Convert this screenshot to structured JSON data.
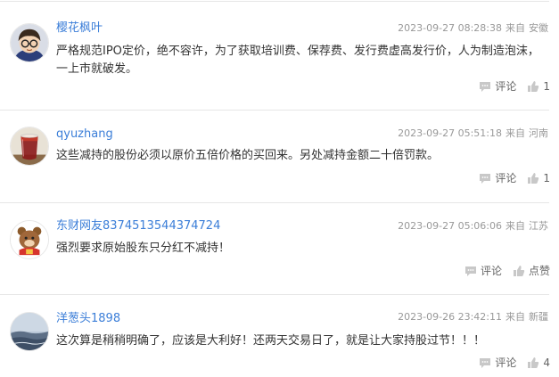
{
  "comments": [
    {
      "username": "樱花枫叶",
      "date": "2023-09-27 08:28:38",
      "source": "来自",
      "location": "安徽",
      "content": "严格规范IPO定价，绝不容许，为了获取培训费、保荐费、发行费虚高发行价，人为制造泡沫，一上市就破发。",
      "reply_label": "评论",
      "like_label": "1"
    },
    {
      "username": "qyuzhang",
      "date": "2023-09-27 05:51:18",
      "source": "来自",
      "location": "河南",
      "content": "这些减持的股份必须以原价五倍价格的买回来。另处减持金额二十倍罚款。",
      "reply_label": "评论",
      "like_label": "1"
    },
    {
      "username": "东财网友8374513544374724",
      "date": "2023-09-27 05:06:06",
      "source": "来自",
      "location": "江苏",
      "content": "强烈要求原始股东只分红不减持！",
      "reply_label": "评论",
      "like_label": "点赞"
    },
    {
      "username": "洋葱头1898",
      "date": "2023-09-26 23:42:11",
      "source": "来自",
      "location": "新疆",
      "content": "这次算是稍稍明确了，应该是大利好！还两天交易日了，就是让大家持股过节！！！",
      "reply_label": "评论",
      "like_label": "4"
    }
  ],
  "icons": {
    "reply": "comment-bubble-icon",
    "like": "thumbs-up-icon"
  },
  "colors": {
    "username": "#3b7ed8",
    "meta": "#999999",
    "text": "#333333",
    "icon": "#c8c8c8",
    "divider": "#e6e6e6"
  }
}
